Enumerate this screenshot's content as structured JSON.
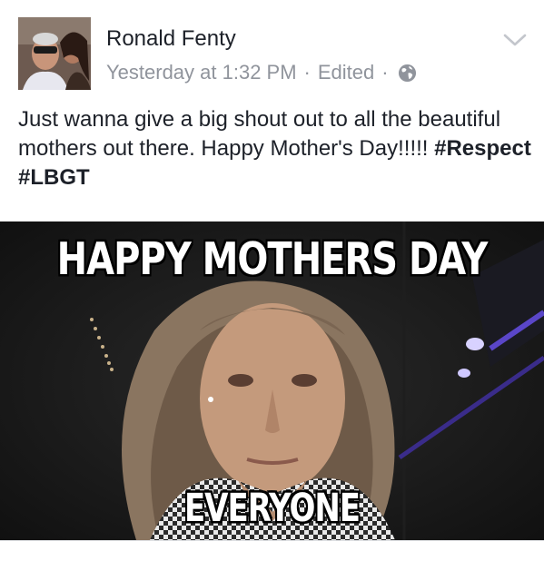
{
  "post": {
    "author": "Ronald Fenty",
    "timestamp": "Yesterday at 1:32 PM",
    "edited_label": "Edited",
    "separator": "·",
    "privacy_icon": "globe-icon",
    "menu_icon": "chevron-down-icon",
    "text_main": "Just wanna give a big shout out to all the beautiful mothers out there. Happy Mother's Day!!!!! ",
    "hashtag1": "#Respect",
    "hashtag2": "#LBGT",
    "image": {
      "caption_top": "HAPPY MOTHERS DAY",
      "caption_bottom": "EVERYONE"
    }
  },
  "colors": {
    "author_text": "#1d2129",
    "meta_text": "#90949c",
    "divider": "#dddfe2"
  }
}
